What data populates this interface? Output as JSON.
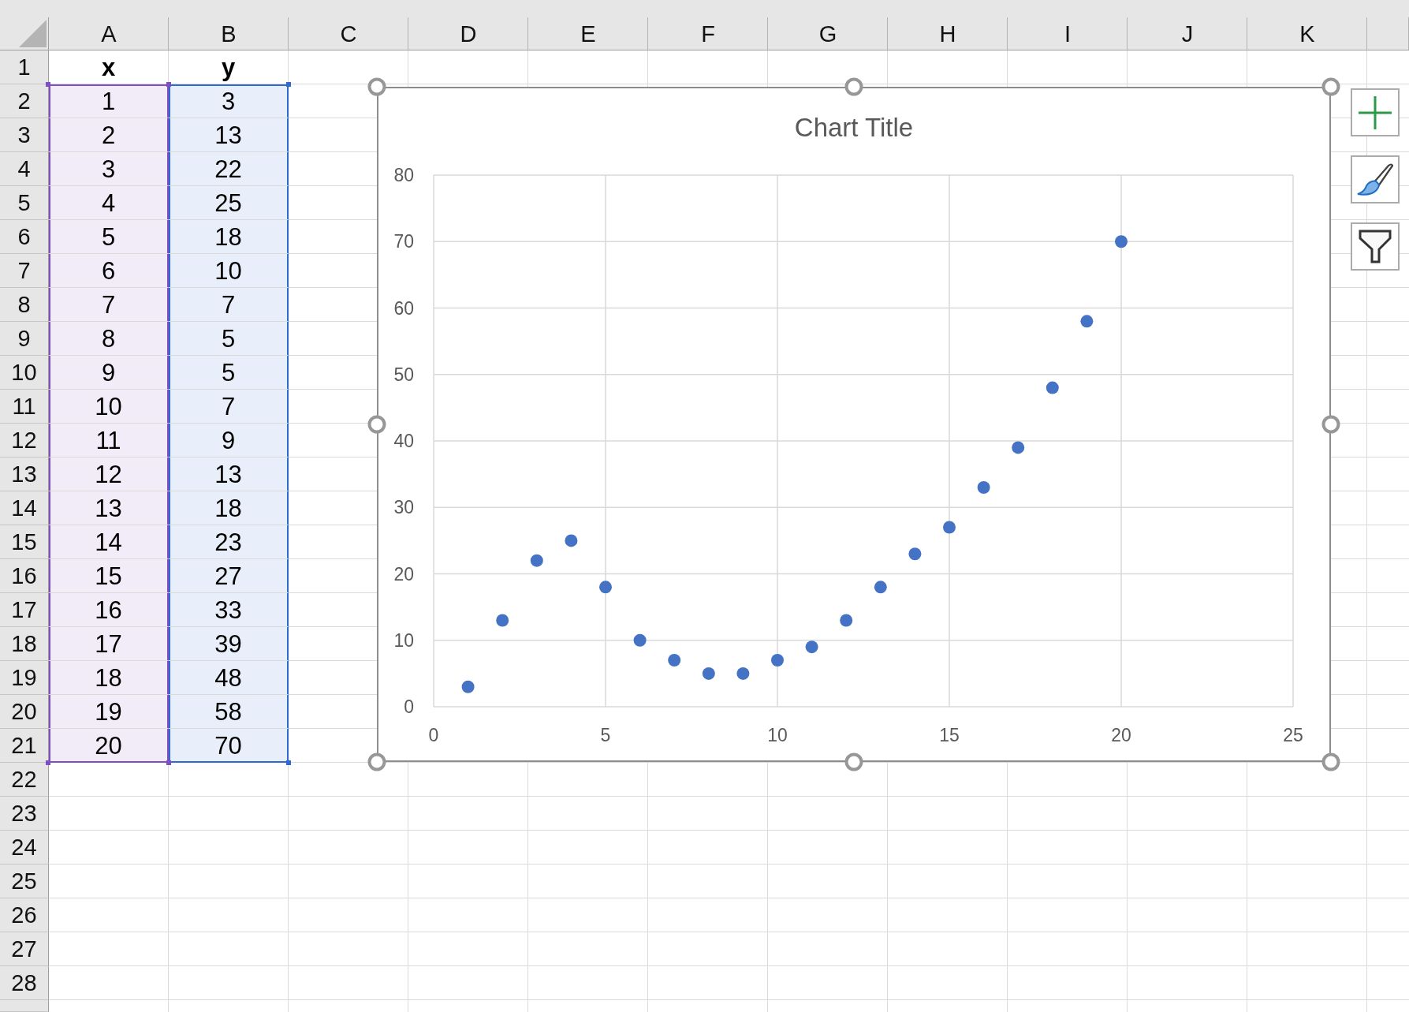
{
  "table": {
    "columns": [
      {
        "label": "A",
        "color": "#7e4fbf"
      },
      {
        "label": "B",
        "color": "#2e6bd0"
      },
      {
        "label": "C"
      },
      {
        "label": "D"
      },
      {
        "label": "E"
      },
      {
        "label": "F"
      },
      {
        "label": "G"
      },
      {
        "label": "H"
      },
      {
        "label": "I"
      },
      {
        "label": "J"
      },
      {
        "label": "K"
      }
    ],
    "rows": [
      {
        "number": "1",
        "highlighted": false,
        "cells": [
          "x",
          "y"
        ]
      },
      {
        "number": "2",
        "highlighted": true,
        "cells": [
          "1",
          "3"
        ]
      },
      {
        "number": "3",
        "highlighted": true,
        "cells": [
          "2",
          "13"
        ]
      },
      {
        "number": "4",
        "highlighted": true,
        "cells": [
          "3",
          "22"
        ]
      },
      {
        "number": "5",
        "highlighted": true,
        "cells": [
          "4",
          "25"
        ]
      },
      {
        "number": "6",
        "highlighted": true,
        "cells": [
          "5",
          "18"
        ]
      },
      {
        "number": "7",
        "highlighted": true,
        "cells": [
          "6",
          "10"
        ]
      },
      {
        "number": "8",
        "highlighted": true,
        "cells": [
          "7",
          "7"
        ]
      },
      {
        "number": "9",
        "highlighted": true,
        "cells": [
          "8",
          "5"
        ]
      },
      {
        "number": "10",
        "highlighted": true,
        "cells": [
          "9",
          "5"
        ]
      },
      {
        "number": "11",
        "highlighted": true,
        "cells": [
          "10",
          "7"
        ]
      },
      {
        "number": "12",
        "highlighted": true,
        "cells": [
          "11",
          "9"
        ]
      },
      {
        "number": "13",
        "highlighted": true,
        "cells": [
          "12",
          "13"
        ]
      },
      {
        "number": "14",
        "highlighted": true,
        "cells": [
          "13",
          "18"
        ]
      },
      {
        "number": "15",
        "highlighted": true,
        "cells": [
          "14",
          "23"
        ]
      },
      {
        "number": "16",
        "highlighted": true,
        "cells": [
          "15",
          "27"
        ]
      },
      {
        "number": "17",
        "highlighted": true,
        "cells": [
          "16",
          "33"
        ]
      },
      {
        "number": "18",
        "highlighted": true,
        "cells": [
          "17",
          "39"
        ]
      },
      {
        "number": "19",
        "highlighted": true,
        "cells": [
          "18",
          "48"
        ]
      },
      {
        "number": "20",
        "highlighted": true,
        "cells": [
          "19",
          "58"
        ]
      },
      {
        "number": "21",
        "highlighted": true,
        "cells": [
          "20",
          "70"
        ]
      },
      {
        "number": "22",
        "highlighted": false
      },
      {
        "number": "23",
        "highlighted": false
      },
      {
        "number": "24",
        "highlighted": false
      },
      {
        "number": "25",
        "highlighted": false
      },
      {
        "number": "26",
        "highlighted": false
      },
      {
        "number": "27",
        "highlighted": false
      },
      {
        "number": "28",
        "highlighted": false
      }
    ]
  },
  "chart": {
    "selected": true,
    "chart_data": {
      "type": "scatter",
      "title": "Chart Title",
      "grid": true,
      "x": [
        1,
        2,
        3,
        4,
        5,
        6,
        7,
        8,
        9,
        10,
        11,
        12,
        13,
        14,
        15,
        16,
        17,
        18,
        19,
        20
      ],
      "series": [
        {
          "color": "#4472c4",
          "values": [
            3,
            13,
            22,
            25,
            18,
            10,
            7,
            5,
            5,
            7,
            9,
            13,
            18,
            23,
            27,
            33,
            39,
            48,
            58,
            70
          ]
        }
      ],
      "xlim": [
        0,
        25
      ],
      "ylim": [
        0,
        80
      ],
      "xticks": [
        0,
        5,
        10,
        15,
        20,
        25
      ],
      "yticks": [
        0,
        10,
        20,
        30,
        40,
        50,
        60,
        70,
        80
      ]
    }
  }
}
